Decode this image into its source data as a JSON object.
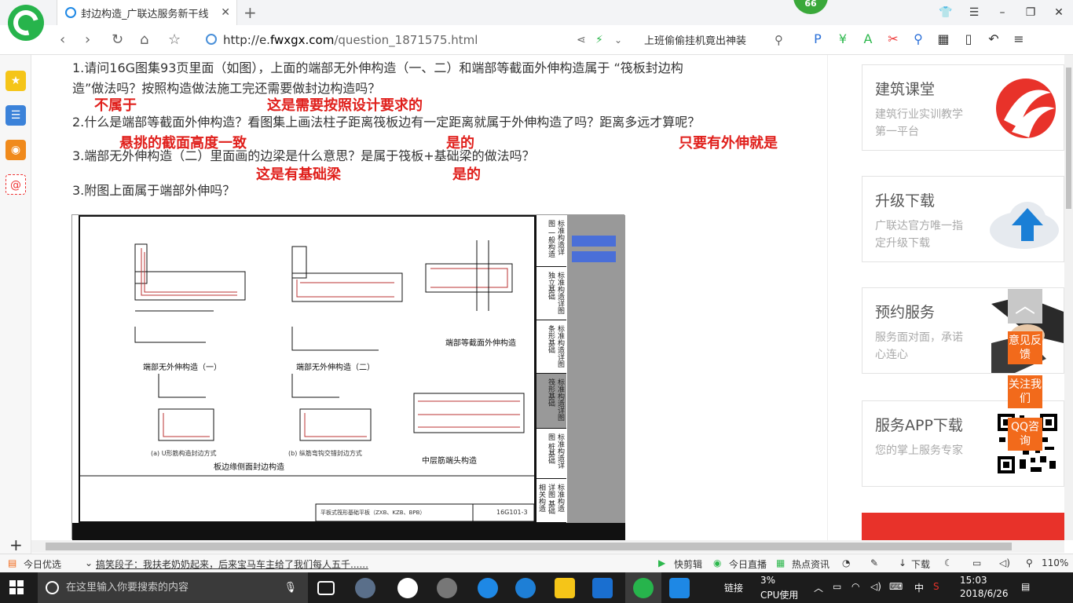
{
  "browser": {
    "tab_title": "封边构造_广联达服务新干线",
    "badge": "66",
    "url_prefix": "http://e.",
    "url_host": "fwxgx.com",
    "url_path": "/question_1871575.html",
    "search_hint": "上班偷偷挂机竟出神装",
    "colors": {
      "brand": "#27b44c",
      "accent": "#f26a1b"
    }
  },
  "questions": {
    "q1_line1": "1.请问16G图集93页里面（如图），上面的端部无外伸构造（一、二）和端部等截面外伸构造属于 “筏板封边构",
    "q1_line2": "造”做法吗？按照构造做法施工完还需要做封边构造吗？",
    "q2": "2.什么是端部等截面外伸构造？看图集上画法柱子距离筏板边有一定距离就属于外伸构造了吗？距离多远才算呢？",
    "q3": "3.端部无外伸构造（二）里面画的边梁是什么意思？是属于筏板+基础梁的做法吗？",
    "q4": "3.附图上面属于端部外伸吗？"
  },
  "answers": {
    "a1": "不属于",
    "a2": "这是需要按照设计要求的",
    "a3": "悬挑的截面高度一致",
    "a4": "是的",
    "a5": "只要有外伸就是",
    "a6": "这是有基础梁",
    "a7": "是的"
  },
  "drawing": {
    "cap1": "端部无外伸构造（一）",
    "cap2": "端部无外伸构造（二）",
    "cap3": "端部等截面外伸构造",
    "cap4": "板边缘侧面封边构造",
    "cap5": "中层筋端头构造",
    "sub_a": "(a) U形筋构造封边方式",
    "sub_b": "(b) 纵筋弯钩交错封边方式",
    "footer_title": "平板式筏形基础平板（ZXB、KZB、BPB）",
    "footer_code": "16G101-3",
    "strip": [
      "标准构造详图 一般构造",
      "标准构造详图 独立基础",
      "标准构造详图 条形基础",
      "标准构造详图 筏形基础",
      "标准构造详图 桩基础",
      "标准构造详图 基础相关构造"
    ]
  },
  "right_cards": [
    {
      "title": "建筑课堂",
      "sub": "建筑行业实训教学第一平台"
    },
    {
      "title": "升级下载",
      "sub": "广联达官方唯一指定升级下载"
    },
    {
      "title": "预约服务",
      "sub": "服务面对面，承诺心连心"
    },
    {
      "title": "服务APP下载",
      "sub": "您的掌上服务专家"
    }
  ],
  "float_buttons": {
    "feedback": "意见反馈",
    "follow": "关注我们",
    "qq": "QQ咨询"
  },
  "statusbar": {
    "today": "今日优选",
    "news": "搞笑段子：我扶老奶奶起来，后来宝马车主给了我们每人五千......",
    "kuaijian": "快剪辑",
    "live": "今日直播",
    "hot": "热点资讯",
    "download": "下载",
    "zoom": "110%"
  },
  "taskbar": {
    "search_placeholder": "在这里输入你要搜索的内容",
    "link": "链接",
    "cpu_percent": "3%",
    "cpu_label": "CPU使用",
    "ime": "中",
    "time": "15:03",
    "date": "2018/6/26"
  }
}
